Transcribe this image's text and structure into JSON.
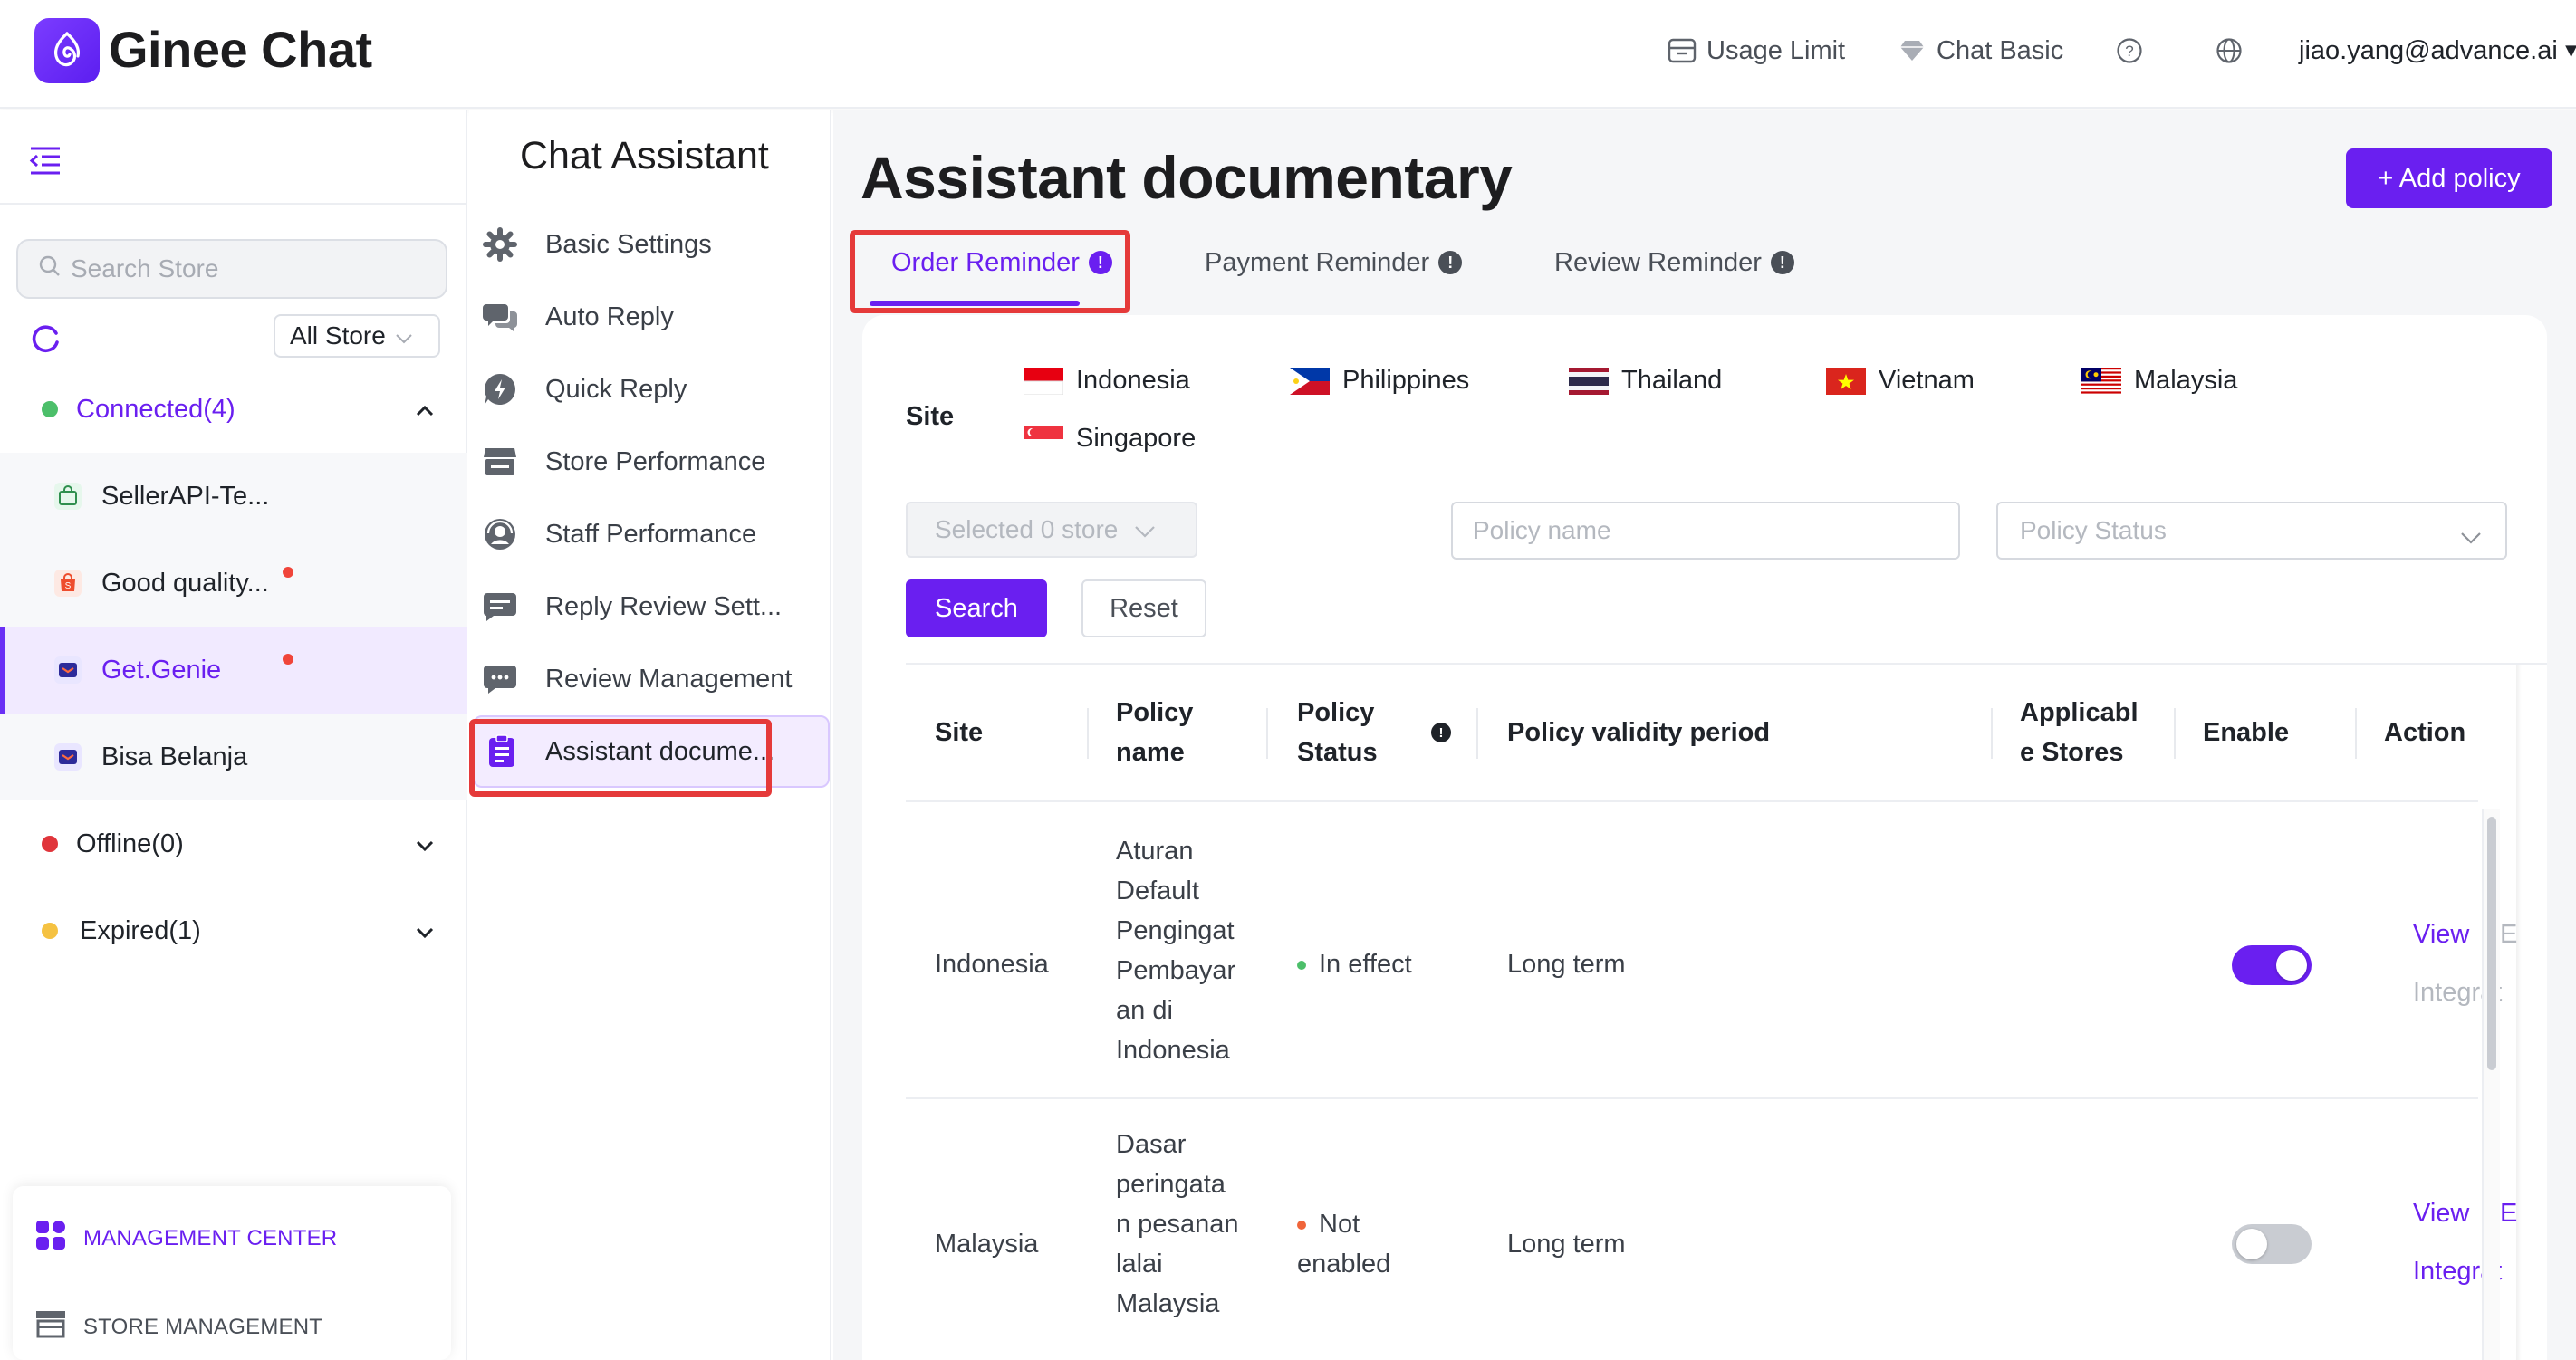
{
  "app": {
    "name": "Ginee Chat"
  },
  "topbar": {
    "usage_limit": "Usage Limit",
    "plan": "Chat Basic",
    "user_email": "jiao.yang@advance.ai"
  },
  "sidebar": {
    "search_placeholder": "Search Store",
    "store_filter": "All Store",
    "groups": {
      "connected": "Connected(4)",
      "offline": "Offline(0)",
      "expired": "Expired(1)"
    },
    "stores": [
      {
        "label": "SellerAPI-Te..."
      },
      {
        "label": "Good quality..."
      },
      {
        "label": "Get.Genie"
      },
      {
        "label": "Bisa Belanja"
      }
    ],
    "management_center": "MANAGEMENT CENTER",
    "store_management": "STORE MANAGEMENT"
  },
  "assistant_menu": {
    "title": "Chat Assistant",
    "items": [
      {
        "label": "Basic Settings"
      },
      {
        "label": "Auto Reply"
      },
      {
        "label": "Quick Reply"
      },
      {
        "label": "Store Performance"
      },
      {
        "label": "Staff Performance"
      },
      {
        "label": "Reply Review Sett..."
      },
      {
        "label": "Review Management"
      },
      {
        "label": "Assistant docume..."
      }
    ]
  },
  "main": {
    "title": "Assistant documentary",
    "add_policy": "+ Add policy",
    "tabs": [
      {
        "label": "Order Reminder"
      },
      {
        "label": "Payment Reminder"
      },
      {
        "label": "Review Reminder"
      }
    ],
    "site_label": "Site",
    "sites": [
      "Indonesia",
      "Philippines",
      "Thailand",
      "Vietnam",
      "Malaysia",
      "Singapore"
    ],
    "filters": {
      "store_select": "Selected 0 store",
      "policy_name_placeholder": "Policy name",
      "policy_status_placeholder": "Policy Status",
      "search": "Search",
      "reset": "Reset"
    },
    "table": {
      "headers": {
        "site": "Site",
        "policy_name_1": "Policy",
        "policy_name_2": "name",
        "policy_status_1": "Policy",
        "policy_status_2": "Status",
        "validity": "Policy validity period",
        "stores_1": "Applicabl",
        "stores_2": "e Stores",
        "enable": "Enable",
        "action": "Action"
      },
      "rows": [
        {
          "site": "Indonesia",
          "name_lines": [
            "Aturan",
            "Default",
            "Pengingat",
            "Pembayar",
            "an di",
            "Indonesia"
          ],
          "status": "In effect",
          "validity": "Long term",
          "enabled": true,
          "view": "View",
          "edit": "E",
          "integrate": "Integrat"
        },
        {
          "site": "Malaysia",
          "name_lines": [
            "Dasar",
            "peringata",
            "n pesanan",
            "lalai",
            "Malaysia"
          ],
          "status_1": "Not",
          "status_2": "enabled",
          "validity": "Long term",
          "enabled": false,
          "view": "View",
          "edit": "E",
          "integrate": "Integrat"
        }
      ]
    }
  },
  "colors": {
    "brand": "#6a1ff0",
    "highlight_box": "#e53a3a",
    "connected": "#4cbf6a",
    "offline": "#e0353b",
    "expired": "#f5c242"
  }
}
